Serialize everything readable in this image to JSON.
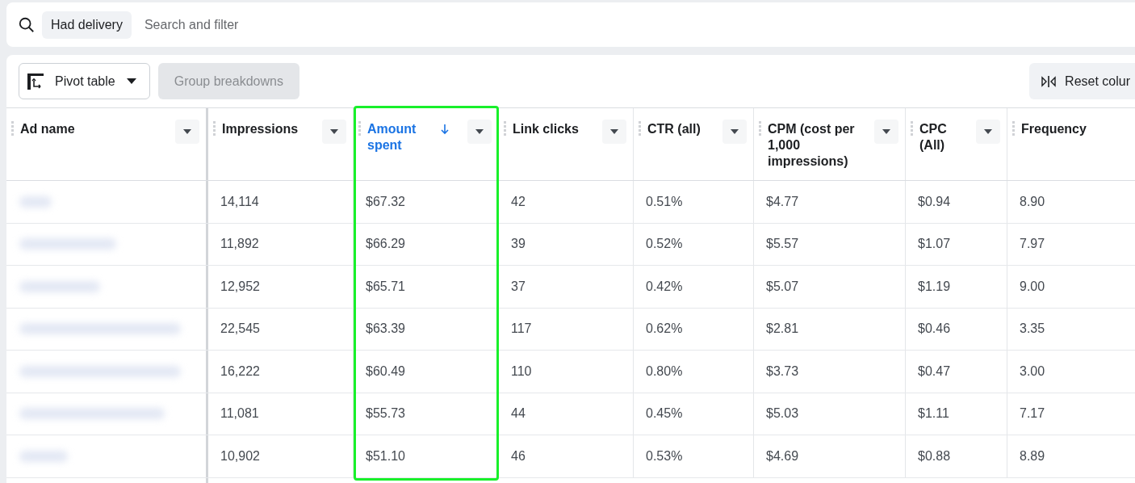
{
  "filter_bar": {
    "chip": "Had delivery",
    "placeholder": "Search and filter"
  },
  "toolbar": {
    "pivot_button": "Pivot table",
    "group_button": {
      "label": "Group breakdowns",
      "disabled": true
    },
    "reset_button": "Reset colur"
  },
  "table": {
    "columns": [
      {
        "label": "Ad name",
        "menu": true,
        "sorted": false,
        "highlighted": false
      },
      {
        "label": "Impressions",
        "menu": true,
        "sorted": false,
        "highlighted": false
      },
      {
        "label": "Amount spent",
        "menu": true,
        "sorted": true,
        "highlighted": true
      },
      {
        "label": "Link clicks",
        "menu": true,
        "sorted": false,
        "highlighted": false
      },
      {
        "label": "CTR (all)",
        "menu": true,
        "sorted": false,
        "highlighted": false
      },
      {
        "label": "CPM (cost per 1,000 impressions)",
        "menu": true,
        "sorted": false,
        "highlighted": false
      },
      {
        "label": "CPC (All)",
        "menu": true,
        "sorted": false,
        "highlighted": false
      },
      {
        "label": "Frequency",
        "menu": false,
        "sorted": false,
        "highlighted": false
      }
    ],
    "rows": [
      {
        "ad_name": {
          "kind": "blurred"
        },
        "cells": [
          "",
          "14,114",
          "$67.32",
          "42",
          "0.51%",
          "$4.77",
          "$0.94",
          "8.90"
        ]
      },
      {
        "ad_name": {
          "kind": "blurred"
        },
        "cells": [
          "",
          "11,892",
          "$66.29",
          "39",
          "0.52%",
          "$5.57",
          "$1.07",
          "7.97"
        ]
      },
      {
        "ad_name": {
          "kind": "blurred"
        },
        "cells": [
          "",
          "12,952",
          "$65.71",
          "37",
          "0.42%",
          "$5.07",
          "$1.19",
          "9.00"
        ]
      },
      {
        "ad_name": {
          "kind": "blurred"
        },
        "cells": [
          "",
          "22,545",
          "$63.39",
          "117",
          "0.62%",
          "$2.81",
          "$0.46",
          "3.35"
        ]
      },
      {
        "ad_name": {
          "kind": "blurred"
        },
        "cells": [
          "",
          "16,222",
          "$60.49",
          "110",
          "0.80%",
          "$3.73",
          "$0.47",
          "3.00"
        ]
      },
      {
        "ad_name": {
          "kind": "blurred"
        },
        "cells": [
          "",
          "11,081",
          "$55.73",
          "44",
          "0.45%",
          "$5.03",
          "$1.11",
          "7.17"
        ]
      },
      {
        "ad_name": {
          "kind": "blurred"
        },
        "cells": [
          "",
          "10,902",
          "$51.10",
          "46",
          "0.53%",
          "$4.69",
          "$0.88",
          "8.89"
        ]
      }
    ]
  }
}
